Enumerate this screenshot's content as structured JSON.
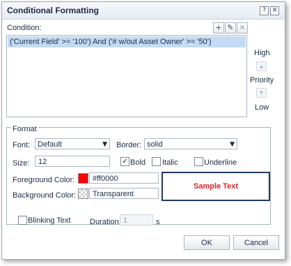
{
  "dialog": {
    "title": "Conditional Formatting",
    "help_glyph": "?",
    "close_glyph": "✕"
  },
  "condition": {
    "label": "Condition:",
    "add_glyph": "+",
    "edit_glyph": "✎",
    "delete_glyph": "✕",
    "rows": [
      "('Current Field' >= '100') And ('# w/out Asset Owner' >= '50')"
    ]
  },
  "priority": {
    "high": "High",
    "label": "Priority",
    "low": "Low",
    "up_glyph": "▲",
    "down_glyph": "▼"
  },
  "format": {
    "legend": "Format",
    "font_label": "Font:",
    "font_value": "Default",
    "border_label": "Border:",
    "border_value": "solid",
    "size_label": "Size:",
    "size_value": "12",
    "bold_label": "Bold",
    "bold_checked": "✓",
    "italic_label": "Italic",
    "underline_label": "Underline",
    "fg_label": "Foreground Color:",
    "fg_value": "#ff0000",
    "bg_label": "Background Color:",
    "bg_value": "Transparent",
    "sample_text": "Sample Text",
    "blink_label": "Blinking Text",
    "duration_label": "Duration:",
    "duration_value": "1",
    "duration_unit": "s",
    "caret_glyph": "▼"
  },
  "buttons": {
    "ok": "OK",
    "cancel": "Cancel"
  },
  "colors": {
    "foreground": "#ff0000",
    "sample_text": "#e02020",
    "selection": "#c4dbf3",
    "sample_border": "#1f3a5c"
  }
}
